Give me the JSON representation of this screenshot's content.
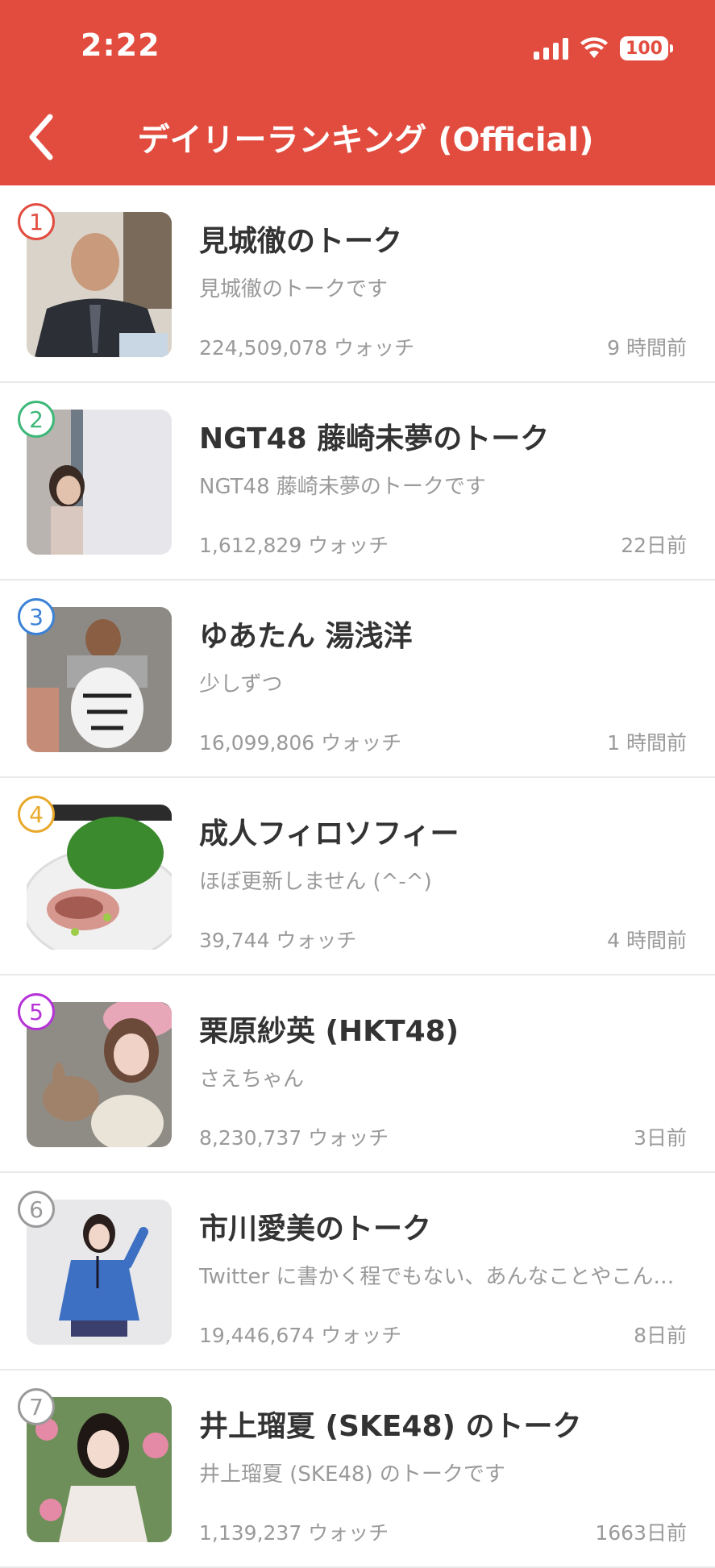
{
  "status": {
    "time": "2:22",
    "battery": "100"
  },
  "header": {
    "title": "デイリーランキング (Official)"
  },
  "colors": {
    "header": "#e24c3f"
  },
  "items": [
    {
      "rank": "1",
      "rank_color": "#e24c3f",
      "title": "見城徹のトーク",
      "desc": "見城徹のトークです",
      "watch": "224,509,078 ウォッチ",
      "time": "9 時間前"
    },
    {
      "rank": "2",
      "rank_color": "#3cb878",
      "title": "NGT48 藤崎未夢のトーク",
      "desc": "NGT48 藤崎未夢のトークです",
      "watch": "1,612,829 ウォッチ",
      "time": "22日前"
    },
    {
      "rank": "3",
      "rank_color": "#3b82d6",
      "title": "ゆあたん 湯浅洋",
      "desc": "少しずつ",
      "watch": "16,099,806 ウォッチ",
      "time": "1 時間前"
    },
    {
      "rank": "4",
      "rank_color": "#e8a92a",
      "title": "成人フィロソフィー",
      "desc": "ほぼ更新しません (^-^)",
      "watch": "39,744 ウォッチ",
      "time": "4 時間前"
    },
    {
      "rank": "5",
      "rank_color": "#b632d8",
      "title": "栗原紗英 (HKT48)",
      "desc": "さえちゃん",
      "watch": "8,230,737 ウォッチ",
      "time": "3日前"
    },
    {
      "rank": "6",
      "rank_color": "#9a9a9a",
      "title": "市川愛美のトーク",
      "desc": "Twitter に書かく程でもない、あんなことやこんなこと…",
      "watch": "19,446,674 ウォッチ",
      "time": "8日前"
    },
    {
      "rank": "7",
      "rank_color": "#9a9a9a",
      "title": "井上瑠夏 (SKE48) のトーク",
      "desc": "井上瑠夏 (SKE48) のトークです",
      "watch": "1,139,237 ウォッチ",
      "time": "1663日前"
    }
  ]
}
